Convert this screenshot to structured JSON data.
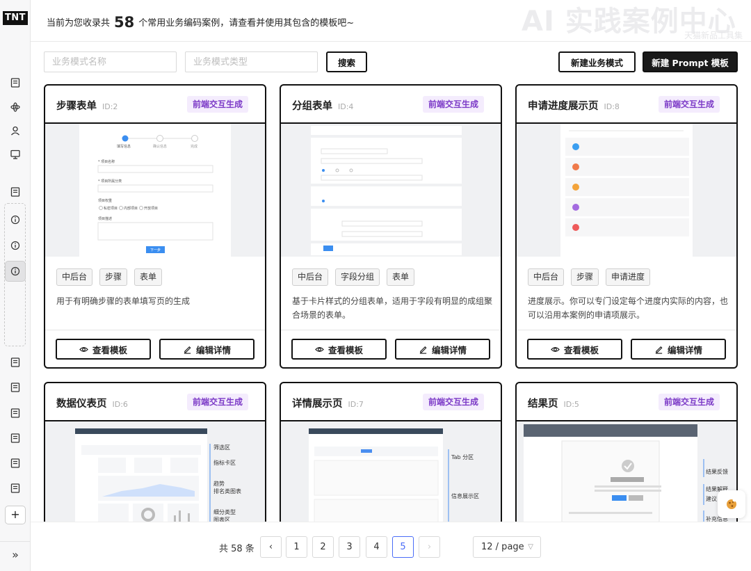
{
  "app": {
    "logo": "TNT"
  },
  "header": {
    "prefix": "当前为您收录共",
    "count": "58",
    "suffix": "个常用业务编码案例，请查看并使用其包含的模板吧~",
    "watermark": "AI 实践案例中心",
    "watermark_sub": "天猫新品工具集"
  },
  "search": {
    "name_placeholder": "业务模式名称",
    "type_placeholder": "业务模式类型",
    "search_label": "搜索"
  },
  "actions": {
    "new_mode": "新建业务模式",
    "new_prompt": "新建 Prompt 模板"
  },
  "cards": [
    {
      "title": "步骤表单",
      "id": "ID:2",
      "badge": "前端交互生成",
      "tags": [
        "中后台",
        "步骤",
        "表单"
      ],
      "desc": "用于有明确步骤的表单填写页的生成",
      "view": "查看模板",
      "edit": "编辑详情"
    },
    {
      "title": "分组表单",
      "id": "ID:4",
      "badge": "前端交互生成",
      "tags": [
        "中后台",
        "字段分组",
        "表单"
      ],
      "desc": "基于卡片样式的分组表单，适用于字段有明显的成组聚合场景的表单。",
      "view": "查看模板",
      "edit": "编辑详情"
    },
    {
      "title": "申请进度展示页",
      "id": "ID:8",
      "badge": "前端交互生成",
      "tags": [
        "中后台",
        "步骤",
        "申请进度"
      ],
      "desc": "进度展示。你可以专门设定每个进度内实际的内容，也可以沿用本案例的申请项展示。",
      "view": "查看模板",
      "edit": "编辑详情"
    },
    {
      "title": "数据仪表页",
      "id": "ID:6",
      "badge": "前端交互生成",
      "annotations": [
        "筛选区",
        "指标卡区",
        "趋势",
        "排名类图表",
        "细分类型",
        "图表区"
      ]
    },
    {
      "title": "详情展示页",
      "id": "ID:7",
      "badge": "前端交互生成",
      "annotations": [
        "Tab 分区",
        "信息展示区"
      ]
    },
    {
      "title": "结果页",
      "id": "ID:5",
      "badge": "前端交互生成",
      "annotations": [
        "结果反馈",
        "结果解释",
        "建议",
        "补充信息"
      ]
    }
  ],
  "preview1": {
    "steps": [
      "填写信息",
      "确认信息",
      "完成"
    ],
    "fields": [
      "* 项目名称",
      "* 项目所属分类",
      "项目权重",
      "项目描述"
    ],
    "radios": [
      "私密项目",
      "内部项目",
      "开放项目"
    ],
    "next": "下一步"
  },
  "pagination": {
    "total": "共 58 条",
    "pages": [
      "1",
      "2",
      "3",
      "4",
      "5"
    ],
    "current": "5",
    "page_size": "12 / page"
  }
}
